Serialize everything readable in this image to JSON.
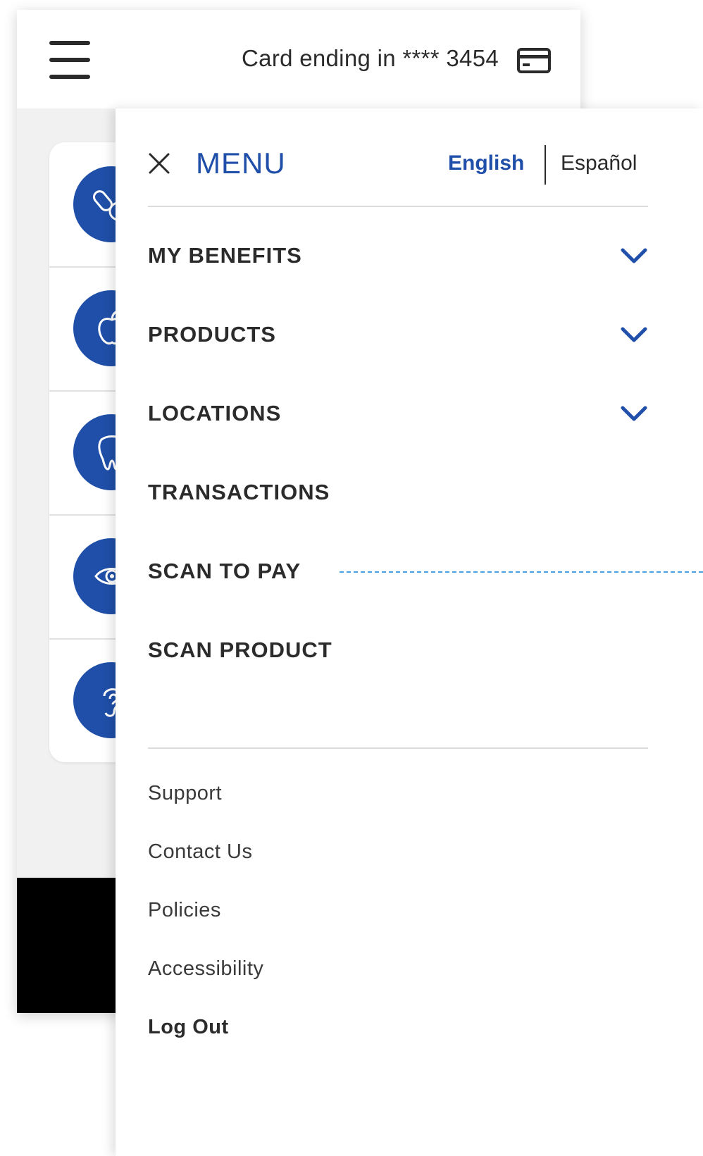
{
  "header": {
    "card_label": "Card ending in **** 3454"
  },
  "benefits": [
    {
      "icon": "pill-icon"
    },
    {
      "icon": "apple-icon"
    },
    {
      "icon": "tooth-icon"
    },
    {
      "icon": "eye-icon"
    },
    {
      "icon": "ear-icon"
    }
  ],
  "menu": {
    "title": "MENU",
    "languages": {
      "english": "English",
      "espanol": "Español"
    },
    "items": [
      {
        "label": "MY BENEFITS",
        "expandable": true
      },
      {
        "label": "PRODUCTS",
        "expandable": true
      },
      {
        "label": "LOCATIONS",
        "expandable": true
      },
      {
        "label": "TRANSACTIONS",
        "expandable": false
      },
      {
        "label": "SCAN TO PAY",
        "expandable": false
      },
      {
        "label": "SCAN PRODUCT",
        "expandable": false
      }
    ],
    "footer_links": [
      {
        "label": "Support"
      },
      {
        "label": "Contact Us"
      },
      {
        "label": "Policies"
      },
      {
        "label": "Accessibility"
      },
      {
        "label": "Log Out"
      }
    ]
  },
  "colors": {
    "brand_blue": "#1f4fa8",
    "text": "#2b2b2b",
    "callout": "#4aa0e0"
  }
}
